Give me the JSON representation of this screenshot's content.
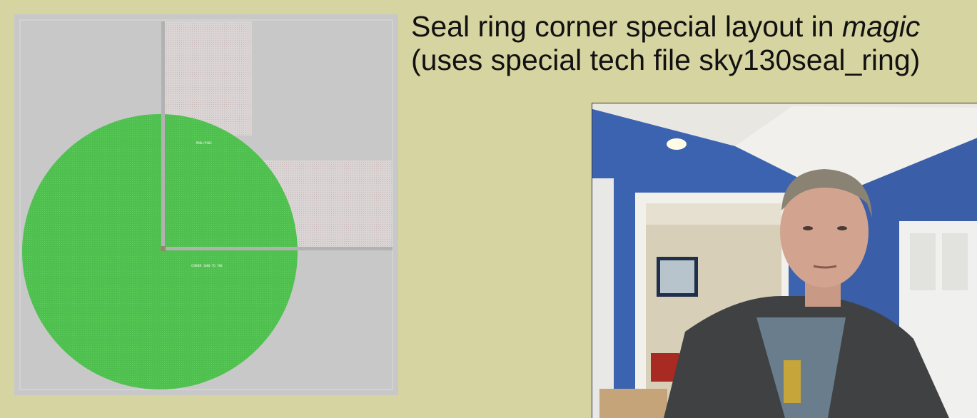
{
  "slide": {
    "title_line1_prefix": "Seal ring corner special layout in ",
    "title_line1_emph": "magic",
    "title_line2": "(uses special tech file sky130seal_ring)"
  },
  "layout_view": {
    "label_upper": "MRDL/PADS",
    "label_lower": "CORNER 1800 TO 700",
    "colors": {
      "background": "#c8c8c8",
      "green_layer": "#4fc04f",
      "stripe_layer": "#dcd6d6",
      "path_layer": "#b4b4b4"
    }
  },
  "webcam": {
    "description_icon": "presenter-video"
  }
}
